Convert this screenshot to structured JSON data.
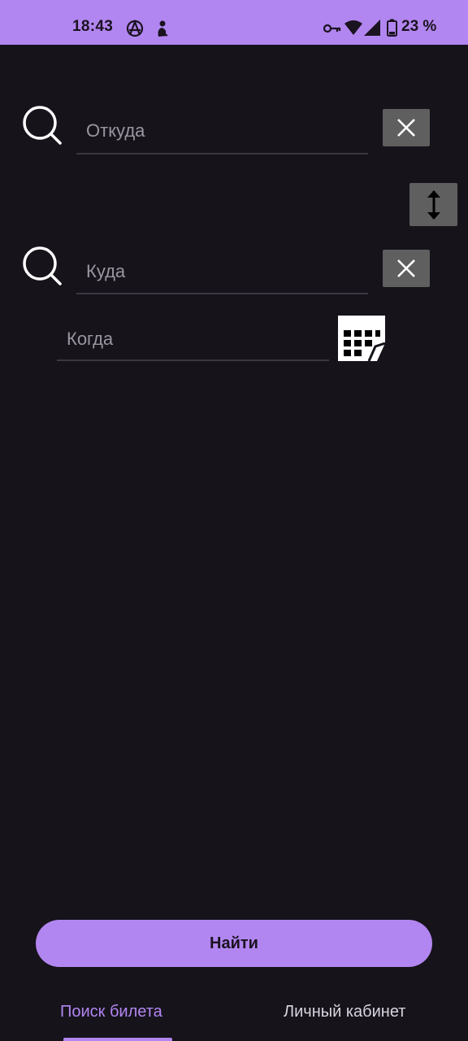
{
  "status_bar": {
    "time": "18:43",
    "battery": "23 %",
    "icons": [
      "anarchy-icon",
      "person-icon",
      "vpn-key-icon",
      "wifi-icon",
      "signal-icon",
      "battery-icon"
    ]
  },
  "form": {
    "from": {
      "placeholder": "Откуда"
    },
    "to": {
      "placeholder": "Куда"
    },
    "date": {
      "placeholder": "Когда"
    }
  },
  "actions": {
    "find_label": "Найти"
  },
  "bottom_nav": {
    "tabs": [
      {
        "label": "Поиск билета",
        "active": true
      },
      {
        "label": "Личный кабинет",
        "active": false
      }
    ]
  },
  "colors": {
    "accent": "#b286f0",
    "background": "#16131b",
    "icon_button": "#5f5f5f"
  }
}
